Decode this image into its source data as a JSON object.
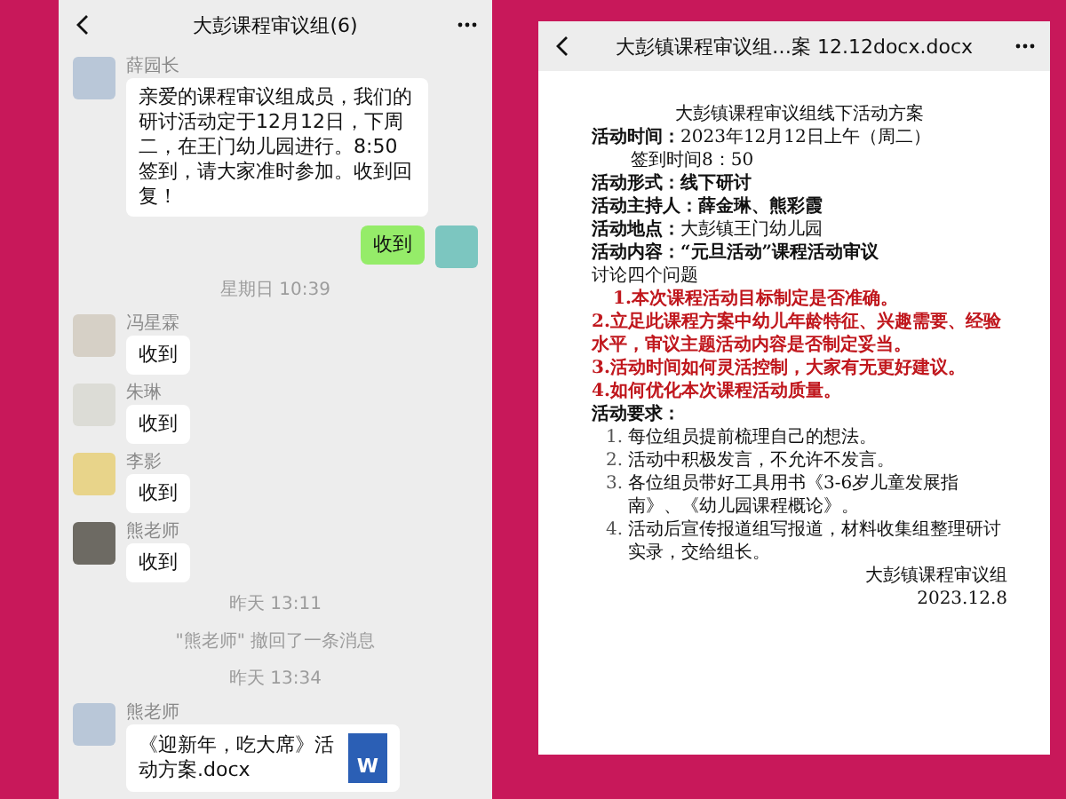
{
  "chat": {
    "title": "大彭课程审议组(6)",
    "messages": [
      {
        "kind": "received",
        "sender": "薛园长",
        "text": "亲爱的课程审议组成员，我们的研讨活动定于12月12日，下周二，在王门幼儿园进行。8:50签到，请大家准时参加。收到回复！"
      },
      {
        "kind": "sent",
        "text": "收到"
      },
      {
        "kind": "time",
        "text": "星期日 10:39"
      },
      {
        "kind": "received",
        "sender": "冯星霖",
        "text": "收到"
      },
      {
        "kind": "received",
        "sender": "朱琳",
        "text": "收到"
      },
      {
        "kind": "received",
        "sender": "李影",
        "text": "收到"
      },
      {
        "kind": "received",
        "sender": "熊老师",
        "text": "收到"
      },
      {
        "kind": "time",
        "text": "昨天 13:11"
      },
      {
        "kind": "time",
        "text": "\"熊老师\" 撤回了一条消息"
      },
      {
        "kind": "time",
        "text": "昨天 13:34"
      },
      {
        "kind": "file",
        "sender": "熊老师",
        "text": "《迎新年，吃大席》活动方案.docx",
        "icon": "W"
      }
    ]
  },
  "document": {
    "title": "大彭镇课程审议组…案 12.12docx.docx",
    "lines": [
      {
        "kind": "title",
        "text": "大彭镇课程审议组线下活动方案"
      },
      {
        "kind": "field",
        "label": "活动时间：",
        "text": "2023年12月12日上午（周二）"
      },
      {
        "kind": "indent",
        "text": "签到时间8：50"
      },
      {
        "kind": "field",
        "label": "活动形式：",
        "text": "线下研讨",
        "bold": true
      },
      {
        "kind": "field",
        "label": "活动主持人：",
        "text": "薛金琳、熊彩霞",
        "bold": true
      },
      {
        "kind": "field",
        "label": "活动地点：",
        "text": "大彭镇王门幼儿园"
      },
      {
        "kind": "field",
        "label": "活动内容：",
        "text": "“元旦活动”课程活动审议",
        "bold": true
      },
      {
        "kind": "plain",
        "text": "讨论四个问题"
      },
      {
        "kind": "red",
        "text": "1.本次课程活动目标制定是否准确。",
        "indent": true
      },
      {
        "kind": "red",
        "text": "2.立足此课程方案中幼儿年龄特征、兴趣需要、经验水平，审议主题活动内容是否制定妥当。"
      },
      {
        "kind": "red",
        "text": "3.活动时间如何灵活控制，大家有无更好建议。"
      },
      {
        "kind": "red",
        "text": "4.如何优化本次课程活动质量。"
      },
      {
        "kind": "heading",
        "text": "活动要求："
      },
      {
        "kind": "item",
        "num": "1.",
        "text": "每位组员提前梳理自己的想法。"
      },
      {
        "kind": "item",
        "num": "2.",
        "text": "活动中积极发言，不允许不发言。"
      },
      {
        "kind": "item",
        "num": "3.",
        "text": "各位组员带好工具用书《3-6岁儿童发展指南》、《幼儿园课程概论》。"
      },
      {
        "kind": "item",
        "num": "4.",
        "text": "活动后宣传报道组写报道，材料收集组整理研讨实录，交给组长。"
      },
      {
        "kind": "sign",
        "text": "大彭镇课程审议组"
      },
      {
        "kind": "sign",
        "text": "2023.12.8"
      }
    ]
  }
}
